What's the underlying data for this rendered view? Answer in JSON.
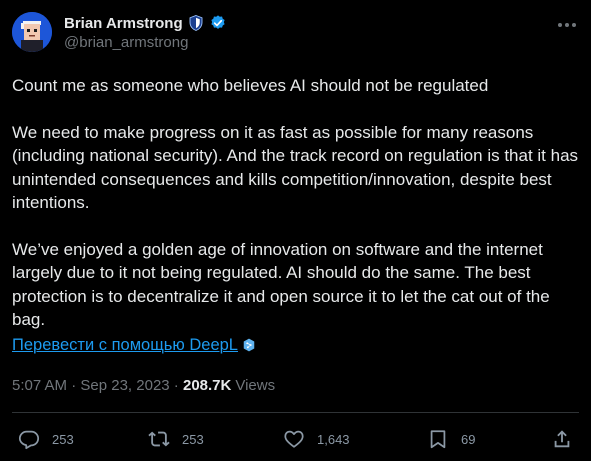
{
  "user": {
    "display_name": "Brian Armstrong",
    "handle": "@brian_armstrong"
  },
  "tweet": {
    "paragraphs": [
      "Count me as someone who believes AI should not be regulated",
      "We need to make progress on it as fast as possible for many reasons (including national security). And the track record on regulation is that it has unintended consequences and kills competition/innovation, despite best intentions.",
      "We’ve enjoyed a golden age of innovation on software and the internet largely due to it not being regulated. AI should do the same. The best protection is to decentralize it and open source it to let the cat out of the bag."
    ],
    "translate_label": "Перевести с помощью DeepL"
  },
  "meta": {
    "time": "5:07 AM",
    "date": "Sep 23, 2023",
    "views_count": "208.7K",
    "views_label": "Views"
  },
  "actions": {
    "replies": "253",
    "reposts": "253",
    "likes": "1,643",
    "bookmarks": "69"
  },
  "colors": {
    "background": "#000000",
    "text_primary": "#e7e9ea",
    "text_secondary": "#71767b",
    "link": "#1d9bf0",
    "verified": "#1d9bf0",
    "divider": "#2f3336"
  },
  "icons": {
    "avatar": "pixel-avatar",
    "badge_shield": "shield-badge-icon",
    "badge_verified": "verified-check-icon",
    "more": "more-dots-icon",
    "deepl": "deepl-logo-icon",
    "reply": "reply-icon",
    "repost": "repost-icon",
    "like": "heart-icon",
    "bookmark": "bookmark-icon",
    "share": "share-icon"
  }
}
